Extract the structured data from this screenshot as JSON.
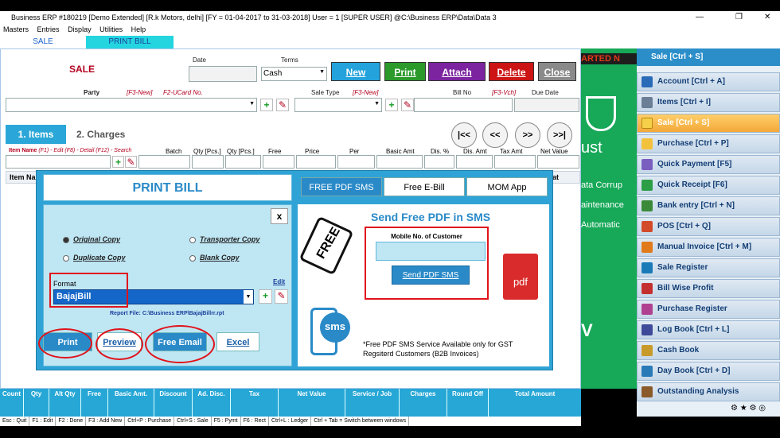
{
  "window": {
    "title": "Business ERP #180219  [Demo Extended]  [R.k Motors, delhi] [FY = 01-04-2017 to 31-03-2018] User = 1 [SUPER USER]  @C:\\Business ERP\\Data\\Data 3"
  },
  "menu": [
    "Masters",
    "Entries",
    "Display",
    "Utilities",
    "Help"
  ],
  "tabs": {
    "sale": "SALE",
    "print_bill": "PRINT BILL"
  },
  "form": {
    "title": "SALE",
    "date_label": "Date",
    "terms_label": "Terms",
    "terms_value": "Cash",
    "party_label": "Party",
    "party_hint": "[F3-New]",
    "ucard_hint": "F2-UCard No.",
    "sale_type_label": "Sale Type",
    "sale_type_hint": "[F3-New]",
    "bill_no_label": "Bill No",
    "bill_no_hint": "[F3-Vch]",
    "due_date_label": "Due Date",
    "items_tab": "1. Items",
    "charges_tab": "2. Charges",
    "nav": [
      "|<<",
      "<<",
      ">>",
      ">>|"
    ],
    "item_row_label": "Item Name",
    "item_row_hints": "(F1) - Edit  (F8) - Detail  (F12) - Search",
    "columns": [
      "Batch",
      "Qty [Pcs.]",
      "Qty [Pcs.]",
      "Free",
      "Price",
      "Per",
      "Basic Amt",
      "Dis. %",
      "Dis. Amt",
      "Tax Amt",
      "Net Value"
    ],
    "grid_header": "Item Na",
    "grid_header_right": "at"
  },
  "toolbar": {
    "new": "New",
    "print": "Print",
    "attach": "Attach",
    "delete": "Delete",
    "close": "Close"
  },
  "bottom_columns": [
    "Count",
    "Qty",
    "Alt Qty",
    "Free",
    "Basic Amt.",
    "Discount",
    "Ad. Disc.",
    "Tax",
    "Net Value",
    "Service / Job",
    "Charges",
    "Round Off",
    "Total Amount"
  ],
  "statusbar": [
    "Esc : Quit",
    "F1 : Edit",
    "F2 : Done",
    "F3 : Add New",
    "Ctrl+P : Purchase",
    "Ctrl+S : Sale",
    "F5 : Pymt",
    "F6 : Rect",
    "Ctrl+L : Ledger",
    "Ctrl + Tab = Switch between windows"
  ],
  "banner": {
    "top": "ARTED N",
    "mid1": "ust",
    "mid2": "ata Corrup",
    "mid3": "aintenance",
    "mid4": "Automatic",
    "bottom": "V"
  },
  "sidebar": {
    "header": "Sale [Ctrl + S]",
    "items": [
      {
        "label": "Account [Ctrl + A]",
        "icon": "account-icon",
        "color": "#2a6bb8"
      },
      {
        "label": "Items [Ctrl + I]",
        "icon": "items-icon",
        "color": "#6a7f96"
      },
      {
        "label": "Sale [Ctrl + S]",
        "icon": "sale-icon",
        "color": "#f7d04a"
      },
      {
        "label": "Purchase [Ctrl + P]",
        "icon": "purchase-icon",
        "color": "#f3c23c"
      },
      {
        "label": "Quick Payment [F5]",
        "icon": "payment-icon",
        "color": "#7a5fc0"
      },
      {
        "label": "Quick Receipt [F6]",
        "icon": "receipt-icon",
        "color": "#2c9e46"
      },
      {
        "label": "Bank entry [Ctrl + N]",
        "icon": "bank-icon",
        "color": "#3a8a3a"
      },
      {
        "label": "POS [Ctrl + Q]",
        "icon": "pos-icon",
        "color": "#d24a2a"
      },
      {
        "label": "Manual Invoice [Ctrl + M]",
        "icon": "invoice-icon",
        "color": "#e07a1a"
      },
      {
        "label": "Sale Register",
        "icon": "register-icon",
        "color": "#1a7ab8"
      },
      {
        "label": "Bill Wise Profit",
        "icon": "profit-icon",
        "color": "#c43030"
      },
      {
        "label": "Purchase Register",
        "icon": "purchase-register-icon",
        "color": "#b04090"
      },
      {
        "label": "Log Book [Ctrl + L]",
        "icon": "logbook-icon",
        "color": "#404a9a"
      },
      {
        "label": "Cash Book",
        "icon": "cashbook-icon",
        "color": "#c89a2a"
      },
      {
        "label": "Day Book [Ctrl + D]",
        "icon": "daybook-icon",
        "color": "#2a7ab8"
      },
      {
        "label": "Outstanding Analysis",
        "icon": "outstanding-icon",
        "color": "#8a5a2a"
      }
    ]
  },
  "dialog": {
    "title": "PRINT BILL",
    "close": "x",
    "radios": {
      "original": "Original Copy",
      "transporter": "Transporter Copy",
      "duplicate": "Duplicate Copy",
      "blank": "Blank Copy"
    },
    "format_label": "Format",
    "edit_link": "Edit",
    "format_value": "BajajBill",
    "report_file": "Report File: C:\\Business ERP\\BajajBillrr.rpt",
    "buttons": {
      "print": "Print",
      "preview": "Preview",
      "email": "Free Email",
      "excel": "Excel"
    },
    "right_tabs": [
      "FREE PDF SMS",
      "Free E-Bill",
      "MOM App"
    ],
    "sms_heading": "Send Free PDF in SMS",
    "mobile_label": "Mobile No. of Customer",
    "send_button": "Send PDF SMS",
    "free_tag": "FREE",
    "sms_badge": "sms",
    "pdf_badge": "pdf",
    "note": "*Free PDF SMS Service Available only for GST  Regsiterd  Customers (B2B Invoices)"
  }
}
